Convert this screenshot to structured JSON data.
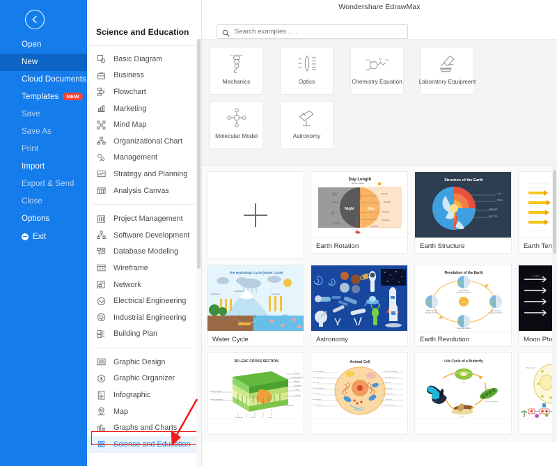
{
  "window": {
    "app_title": "Wondershare EdrawMax"
  },
  "backstage": {
    "back_icon": "back-arrow-icon",
    "items": [
      {
        "label": "Open",
        "state": "normal",
        "icon": ""
      },
      {
        "label": "New",
        "state": "active",
        "icon": ""
      },
      {
        "label": "Cloud Documents",
        "state": "normal",
        "icon": ""
      },
      {
        "label": "Templates",
        "state": "normal",
        "icon": "",
        "badge": "NEW"
      },
      {
        "label": "Save",
        "state": "dim",
        "icon": ""
      },
      {
        "label": "Save As",
        "state": "dim",
        "icon": ""
      },
      {
        "label": "Print",
        "state": "dim",
        "icon": ""
      },
      {
        "label": "Import",
        "state": "normal",
        "icon": ""
      },
      {
        "label": "Export & Send",
        "state": "dim",
        "icon": ""
      },
      {
        "label": "Close",
        "state": "dim",
        "icon": ""
      },
      {
        "label": "Options",
        "state": "normal",
        "icon": ""
      },
      {
        "label": "Exit",
        "state": "normal",
        "icon": "minus-circle-icon"
      }
    ]
  },
  "category_panel": {
    "title": "Science and Education",
    "groups": [
      {
        "items": [
          {
            "label": "Basic Diagram",
            "icon": "basic-diagram-icon"
          },
          {
            "label": "Business",
            "icon": "briefcase-icon"
          },
          {
            "label": "Flowchart",
            "icon": "flowchart-icon"
          },
          {
            "label": "Marketing",
            "icon": "bar-chart-icon"
          },
          {
            "label": "Mind Map",
            "icon": "mind-map-icon"
          },
          {
            "label": "Organizational Chart",
            "icon": "org-chart-icon"
          },
          {
            "label": "Management",
            "icon": "management-icon"
          },
          {
            "label": "Strategy and Planning",
            "icon": "strategy-icon"
          },
          {
            "label": "Analysis Canvas",
            "icon": "canvas-icon"
          }
        ]
      },
      {
        "items": [
          {
            "label": "Project Management",
            "icon": "gantt-icon"
          },
          {
            "label": "Software Development",
            "icon": "software-icon"
          },
          {
            "label": "Database Modeling",
            "icon": "database-icon"
          },
          {
            "label": "Wireframe",
            "icon": "wireframe-icon"
          },
          {
            "label": "Network",
            "icon": "network-icon"
          },
          {
            "label": "Electrical Engineering",
            "icon": "electrical-icon"
          },
          {
            "label": "Industrial Engineering",
            "icon": "industrial-icon"
          },
          {
            "label": "Building Plan",
            "icon": "building-icon"
          }
        ]
      },
      {
        "items": [
          {
            "label": "Graphic Design",
            "icon": "image-icon"
          },
          {
            "label": "Graphic Organizer",
            "icon": "organizer-icon"
          },
          {
            "label": "Infographic",
            "icon": "infographic-icon"
          },
          {
            "label": "Map",
            "icon": "map-pin-icon"
          },
          {
            "label": "Graphs and Charts",
            "icon": "graphs-icon"
          },
          {
            "label": "Science and Education",
            "icon": "atom-icon",
            "selected": true
          }
        ]
      }
    ],
    "selected": "Science and Education",
    "selection_highlight_color": "#ee1c1c"
  },
  "search": {
    "placeholder": "Search examples . . .",
    "value": "",
    "icon": "search-icon"
  },
  "subcategories": [
    {
      "label": "Mechanics",
      "icon": "pulley-icon"
    },
    {
      "label": "Optics",
      "icon": "lens-icon"
    },
    {
      "label": "Chemistry Equation",
      "icon": "molecule-chain-icon"
    },
    {
      "label": "Laboratory Equipment",
      "icon": "microscope-icon"
    },
    {
      "label": "Molecular Model",
      "icon": "molecular-model-icon"
    },
    {
      "label": "Astronomy",
      "icon": "telescope-icon"
    }
  ],
  "gallery": {
    "new_document": {
      "label": "",
      "icon": "plus-icon"
    },
    "rows": [
      [
        {
          "title": "Earth Rotation",
          "thumb_title": "Day Length",
          "thumb": "earth-rotation"
        },
        {
          "title": "Earth Structure",
          "thumb_title": "Structure of the Earth",
          "thumb": "earth-structure"
        },
        {
          "title": "Earth Tempe",
          "thumb_title": "",
          "thumb": "earth-temperature"
        }
      ],
      [
        {
          "title": "Water Cycle",
          "thumb_title": "The Hydrologic Cycle (Water Cycle)",
          "thumb": "water-cycle"
        },
        {
          "title": "Astronomy",
          "thumb_title": "",
          "thumb": "astronomy"
        },
        {
          "title": "Earth Revolution",
          "thumb_title": "Revolution of the Earth",
          "thumb": "earth-revolution"
        },
        {
          "title": "Moon Phase",
          "thumb_title": "",
          "thumb": "moon-phase"
        }
      ],
      [
        {
          "title": "",
          "thumb_title": "3D LEAF CROSS SECTION",
          "thumb": "leaf-cross-section"
        },
        {
          "title": "",
          "thumb_title": "Animal Cell",
          "thumb": "animal-cell"
        },
        {
          "title": "",
          "thumb_title": "Life Cycle of a Butterfly",
          "thumb": "butterfly-life-cycle"
        },
        {
          "title": "",
          "thumb_title": "",
          "thumb": "plant-cell"
        }
      ]
    ]
  },
  "colors": {
    "rail_blue": "#157ceb",
    "rail_active_blue": "#0c64c4",
    "badge_red": "#fc4338",
    "selection_red": "#ee1c1c",
    "selected_item_blue": "#1a7fe0",
    "panel_bg": "#f4f4f4"
  }
}
